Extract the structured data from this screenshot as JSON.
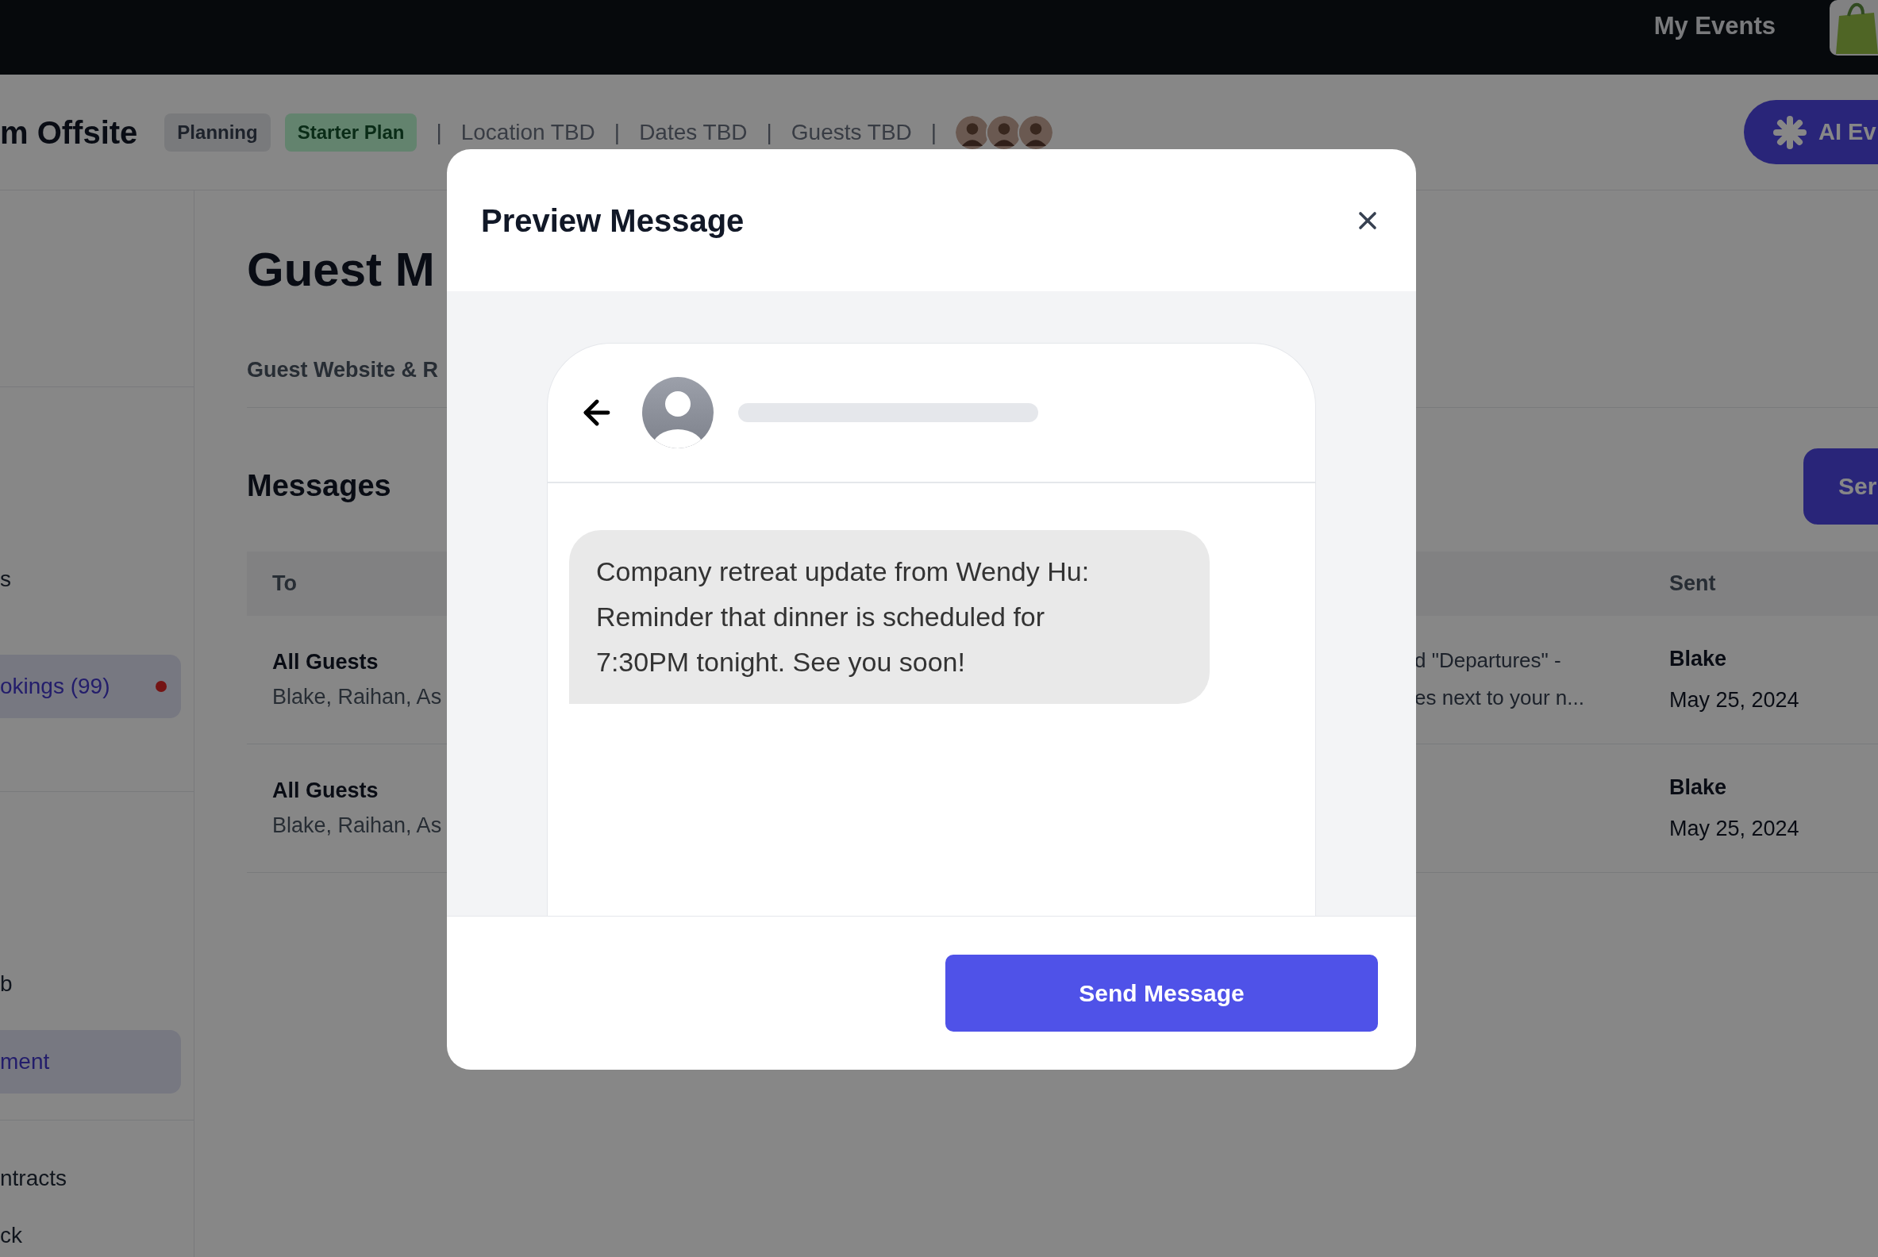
{
  "top_bar": {
    "nav_link": "My Events"
  },
  "event_header": {
    "title": "m Offsite",
    "badges": [
      {
        "label": "Planning",
        "kind": "status"
      },
      {
        "label": "Starter Plan",
        "kind": "plan"
      }
    ],
    "details": [
      {
        "separator": "|",
        "label": "Location TBD"
      },
      {
        "separator": "|",
        "label": "Dates TBD"
      },
      {
        "separator": "|",
        "label": "Guests TBD"
      }
    ],
    "trailing_separator": "|",
    "guest_avatars": [
      {
        "kind": "photo"
      },
      {
        "kind": "photo"
      },
      {
        "kind": "photo"
      }
    ],
    "ai_button": "AI Ev"
  },
  "sidebar": {
    "sections": [
      {
        "items": [
          {
            "label": "s",
            "selected": false,
            "alert": false
          },
          {
            "label": "okings (99)",
            "selected": true,
            "alert": true
          }
        ]
      },
      {
        "items": [
          {
            "label": "b",
            "selected": false,
            "alert": false
          },
          {
            "label": "ment",
            "selected": true,
            "alert": false
          }
        ]
      },
      {
        "items": [
          {
            "label": "ntracts",
            "selected": false,
            "alert": false
          },
          {
            "label": "ck",
            "selected": false,
            "alert": false
          }
        ]
      }
    ]
  },
  "page": {
    "heading": "Guest M",
    "tab": "Guest Website & R"
  },
  "messages": {
    "title": "Messages",
    "send_button": "Ser",
    "columns": [
      "To",
      "Sent"
    ],
    "rows": [
      {
        "to": "All Guests",
        "recipients": "Blake, Raihan, As",
        "message_lines": [
          "d \"Departures\" -",
          "es next to your n..."
        ],
        "sender": "Blake",
        "date": "May 25, 2024"
      },
      {
        "to": "All Guests",
        "recipients": "Blake, Raihan, As",
        "sender": "Blake",
        "date": "May 25, 2024"
      }
    ]
  },
  "modal": {
    "title": "Preview Message",
    "message": "Company retreat update from Wendy Hu: Reminder that dinner is scheduled for 7:30PM tonight. See you soon!",
    "send_button": "Send Message"
  }
}
